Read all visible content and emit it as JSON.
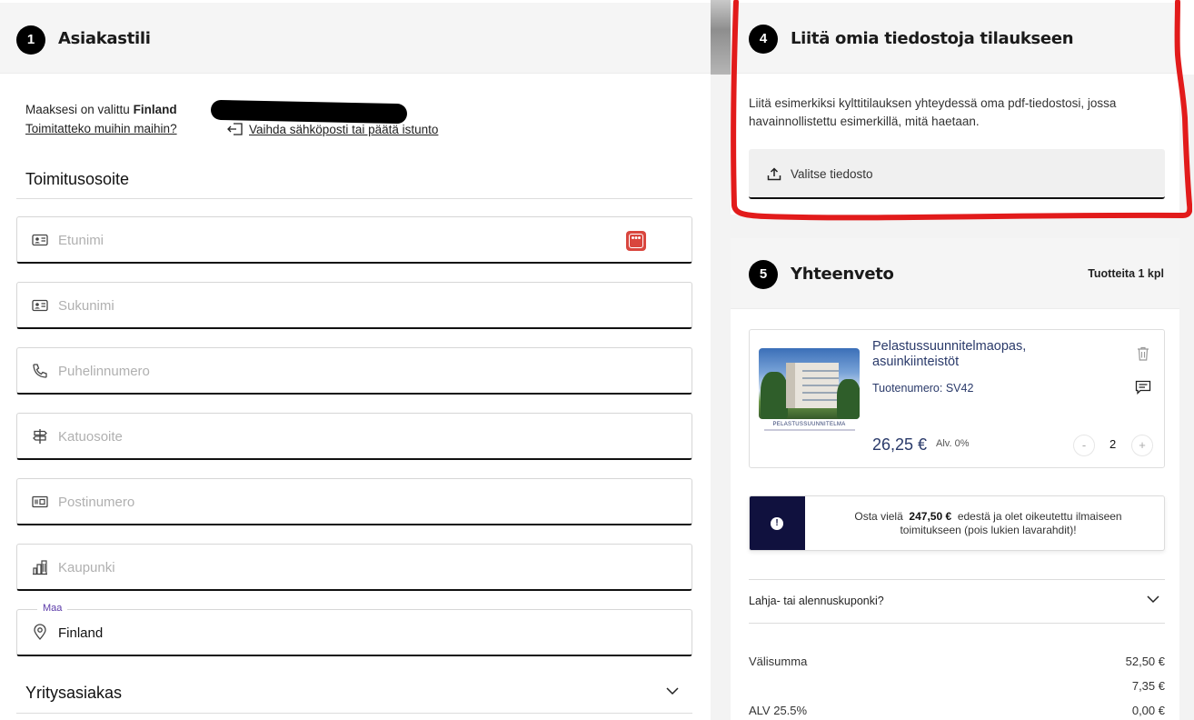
{
  "account": {
    "step": "1",
    "title": "Asiakastili",
    "country_prefix": "Maaksesi on valittu",
    "country_value": "Finland",
    "other_countries_link": "Toimitatteko muihin maihin?",
    "change_link": "Vaihda sähköposti tai päätä istunto"
  },
  "delivery": {
    "heading": "Toimitusosoite",
    "fields": [
      {
        "icon": "id-card-icon",
        "placeholder": "Etunimi"
      },
      {
        "icon": "id-card-icon",
        "placeholder": "Sukunimi"
      },
      {
        "icon": "phone-icon",
        "placeholder": "Puhelinnumero"
      },
      {
        "icon": "signpost-icon",
        "placeholder": "Katuosoite"
      },
      {
        "icon": "postcode-icon",
        "placeholder": "Postinumero"
      },
      {
        "icon": "city-icon",
        "placeholder": "Kaupunki"
      }
    ],
    "country_field": {
      "label": "Maa",
      "value": "Finland",
      "icon": "location-pin-icon"
    },
    "password_manager_badge": "•••"
  },
  "company": {
    "heading": "Yritysasiakas"
  },
  "attach": {
    "step": "4",
    "title": "Liitä omia tiedostoja tilaukseen",
    "description": "Liitä esimerkiksi kylttitilauksen yhteydessä oma pdf-tiedostosi, jossa havainnollistettu esimerkillä, mitä haetaan.",
    "button_label": "Valitse tiedosto"
  },
  "summary": {
    "step": "5",
    "title": "Yhteenveto",
    "count_label": "Tuotteita 1 kpl",
    "product": {
      "name": "Pelastussuunnitelmaopas, asuinkiinteistöt",
      "code": "Tuotenumero: SV42",
      "price": "26,25 €",
      "vat": "Alv. 0%",
      "quantity": "2",
      "minus": "-",
      "plus": "+",
      "image_caption": "PELASTUSSUUNNITELMA"
    },
    "notice": {
      "icon": "!",
      "prefix": "Osta vielä",
      "amount": "247,50 €",
      "suffix": "edestä ja olet oikeutettu ilmaiseen toimitukseen (pois lukien lavarahdit)!"
    },
    "coupon_label": "Lahja- tai alennuskuponki?",
    "totals": [
      {
        "label": "Välisumma",
        "value": "52,50 €"
      },
      {
        "label": "",
        "value": "7,35 €"
      },
      {
        "label": "ALV 25.5%",
        "value": "0,00 €"
      }
    ]
  },
  "colors": {
    "accent_dark": "#10113e",
    "annotation_red": "#e21b1b",
    "product_text": "#2a3a6a"
  }
}
